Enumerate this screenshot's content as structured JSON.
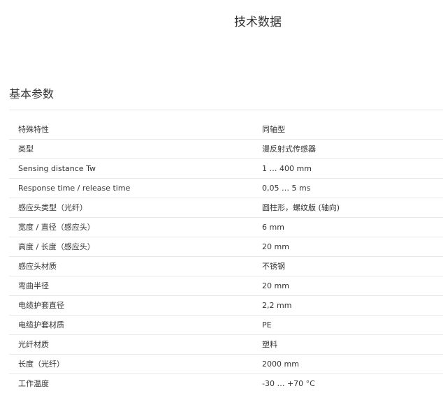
{
  "header": {
    "title": "技术数据"
  },
  "section": {
    "title": "基本参数"
  },
  "specs": [
    {
      "label": "特殊特性",
      "value": "同轴型"
    },
    {
      "label": "类型",
      "value": "漫反射式传感器"
    },
    {
      "label": "Sensing distance Tw",
      "value": "1 … 400 mm"
    },
    {
      "label": "Response time / release time",
      "value": "0,05 … 5 ms"
    },
    {
      "label": "感应头类型（光纤）",
      "value": "圆柱形，螺纹版 (轴向)"
    },
    {
      "label": "宽度 / 直径（感应头）",
      "value": "6 mm"
    },
    {
      "label": "高度 / 长度（感应头）",
      "value": "20 mm"
    },
    {
      "label": "感应头材质",
      "value": "不锈钢"
    },
    {
      "label": "弯曲半径",
      "value": "20 mm"
    },
    {
      "label": "电缆护套直径",
      "value": "2,2 mm"
    },
    {
      "label": "电缆护套材质",
      "value": "PE"
    },
    {
      "label": "光纤材质",
      "value": "塑料"
    },
    {
      "label": "长度（光纤）",
      "value": "2000 mm"
    },
    {
      "label": "工作温度",
      "value": "-30 … +70 °C"
    }
  ]
}
